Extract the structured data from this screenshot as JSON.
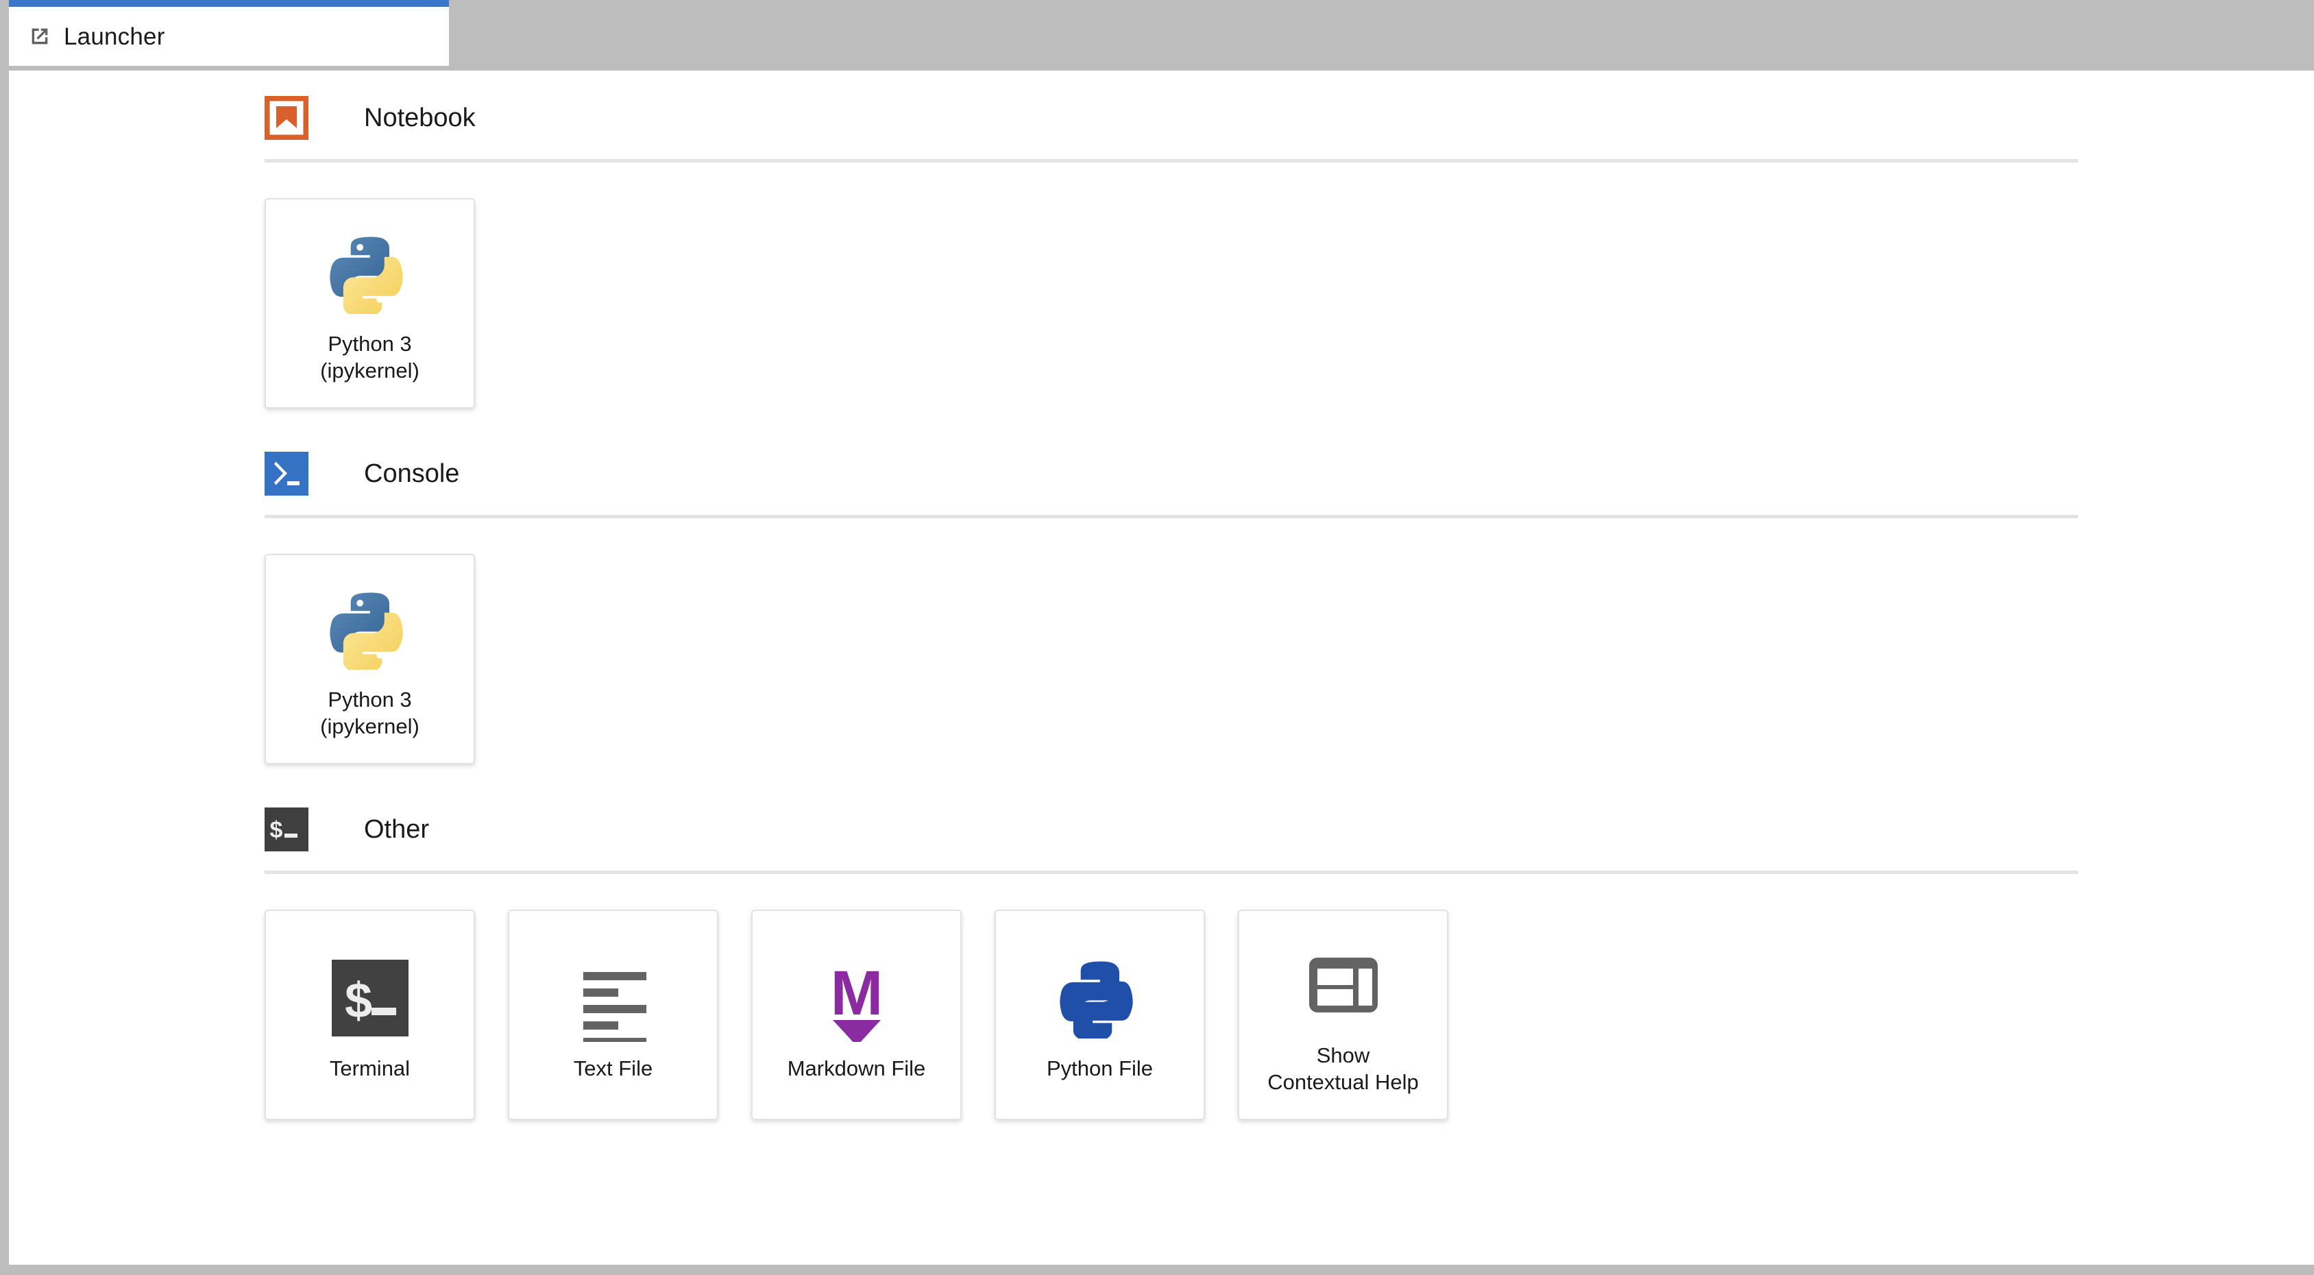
{
  "window": {
    "frame_color": "#bdbdbd",
    "background": "#ffffff"
  },
  "tab_bar": {
    "active_tab": {
      "label": "Launcher",
      "icon": "external-link-icon",
      "accent_color": "#3a76c9"
    }
  },
  "launcher": {
    "sections": [
      {
        "id": "notebook",
        "title": "Notebook",
        "icon": "notebook-bookmark-icon",
        "icon_color": "#d9602a",
        "cards": [
          {
            "id": "python3-notebook",
            "label": "Python 3\n(ipykernel)",
            "icon": "python-logo-color-icon"
          }
        ]
      },
      {
        "id": "console",
        "title": "Console",
        "icon": "console-prompt-icon",
        "icon_color": "#3472c4",
        "cards": [
          {
            "id": "python3-console",
            "label": "Python 3\n(ipykernel)",
            "icon": "python-logo-color-icon"
          }
        ]
      },
      {
        "id": "other",
        "title": "Other",
        "icon": "terminal-dollar-icon",
        "icon_color": "#3f3f3f",
        "cards": [
          {
            "id": "terminal",
            "label": "Terminal",
            "icon": "terminal-dollar-icon"
          },
          {
            "id": "text-file",
            "label": "Text File",
            "icon": "text-lines-icon"
          },
          {
            "id": "markdown-file",
            "label": "Markdown File",
            "icon": "markdown-m-arrow-icon"
          },
          {
            "id": "python-file",
            "label": "Python File",
            "icon": "python-logo-mono-icon"
          },
          {
            "id": "show-contextual-help",
            "label": "Show\nContextual Help",
            "icon": "contextual-help-panels-icon"
          }
        ]
      }
    ]
  },
  "colors": {
    "accent_blue": "#3a76c9",
    "notebook_orange": "#d9602a",
    "console_blue": "#3472c4",
    "terminal_dark": "#3f3f3f",
    "markdown_purple": "#8a2ba2",
    "python_blue": "#3e6c9e",
    "python_yellow": "#f8d96b",
    "python_mono_blue": "#1f4fa8",
    "text_gray": "#616161",
    "divider_gray": "#e3e3e3",
    "frame_gray": "#bdbdbd"
  }
}
